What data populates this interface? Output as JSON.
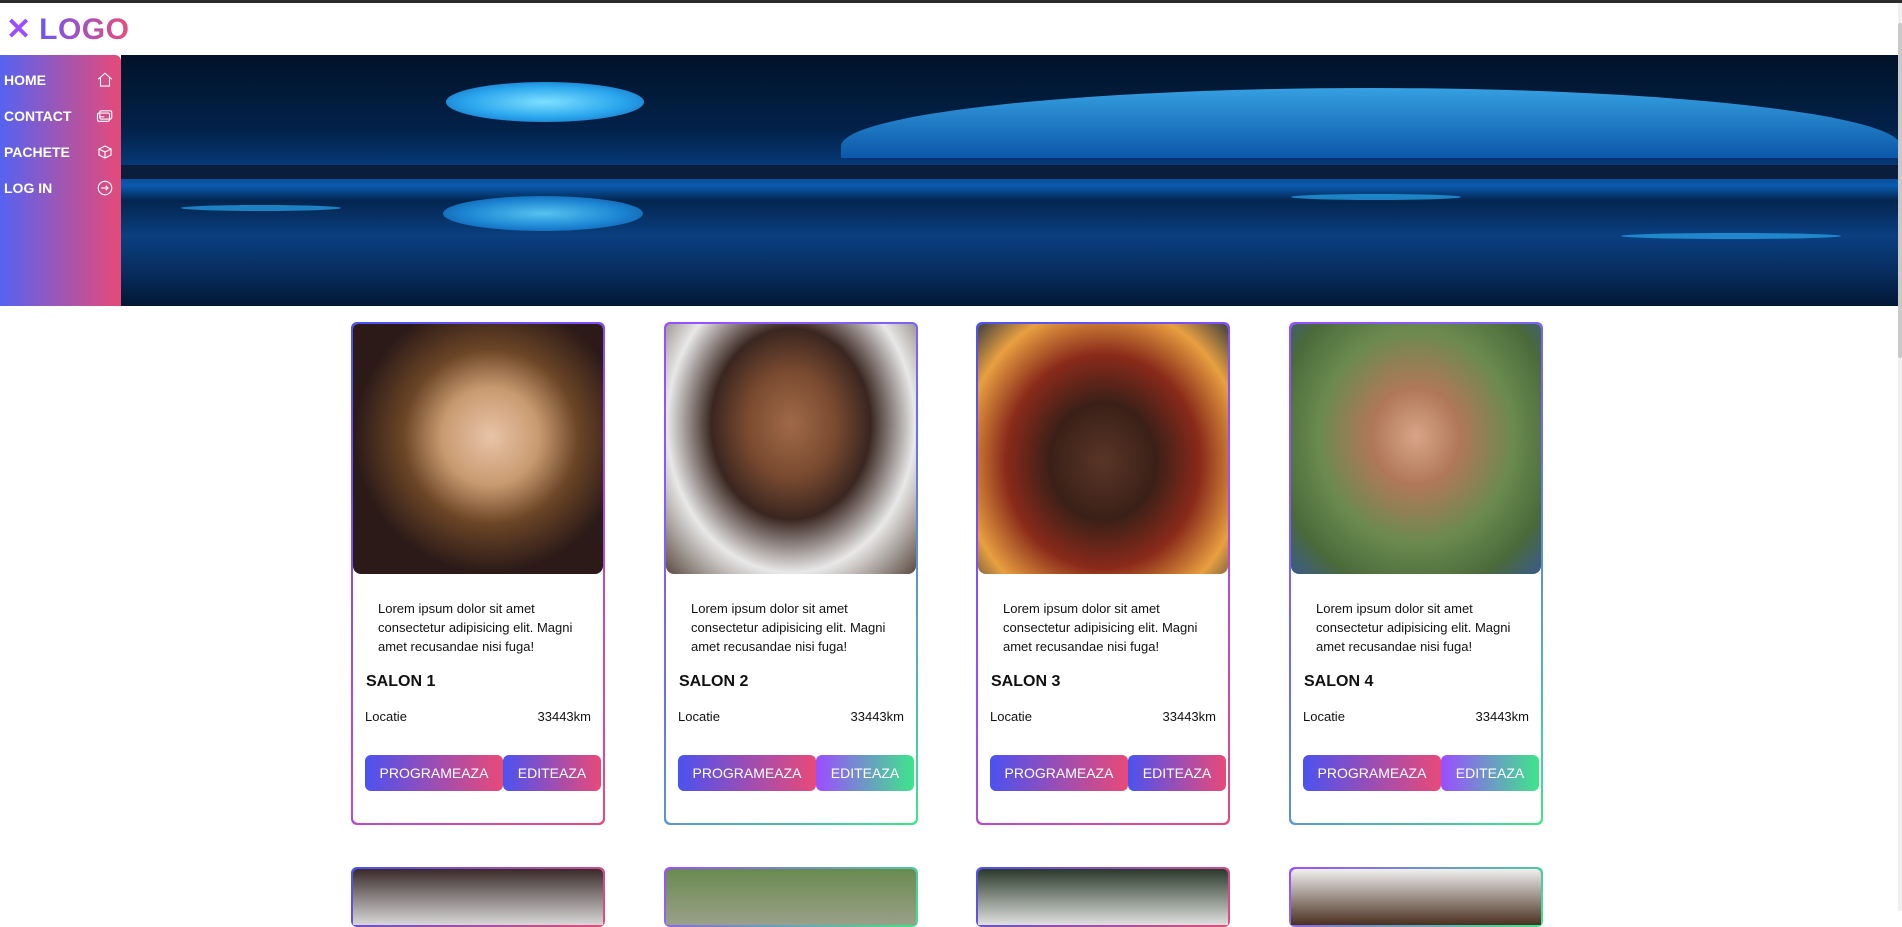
{
  "header": {
    "logo_mark": "✕",
    "logo_text": "LOGO"
  },
  "sidebar": {
    "items": [
      {
        "label": "HOME",
        "icon": "home-icon"
      },
      {
        "label": "CONTACT",
        "icon": "contact-card-icon"
      },
      {
        "label": "PACHETE",
        "icon": "package-icon"
      },
      {
        "label": "LOG IN",
        "icon": "login-icon"
      }
    ]
  },
  "cards": [
    {
      "description": "Lorem ipsum dolor sit amet consectetur adipisicing elit. Magni amet recusandae nisi fuga!",
      "title": "SALON 1",
      "location_label": "Locatie",
      "distance": "33443km",
      "primary_button": "PROGRAMEAZA",
      "secondary_button": "EDITEAZA"
    },
    {
      "description": "Lorem ipsum dolor sit amet consectetur adipisicing elit. Magni amet recusandae nisi fuga!",
      "title": "SALON 2",
      "location_label": "Locatie",
      "distance": "33443km",
      "primary_button": "PROGRAMEAZA",
      "secondary_button": "EDITEAZA"
    },
    {
      "description": "Lorem ipsum dolor sit amet consectetur adipisicing elit. Magni amet recusandae nisi fuga!",
      "title": "SALON 3",
      "location_label": "Locatie",
      "distance": "33443km",
      "primary_button": "PROGRAMEAZA",
      "secondary_button": "EDITEAZA"
    },
    {
      "description": "Lorem ipsum dolor sit amet consectetur adipisicing elit. Magni amet recusandae nisi fuga!",
      "title": "SALON 4",
      "location_label": "Locatie",
      "distance": "33443km",
      "primary_button": "PROGRAMEAZA",
      "secondary_button": "EDITEAZA"
    }
  ],
  "colors": {
    "accent_blue": "#4c52ef",
    "accent_pink": "#e84a78",
    "accent_purple": "#9b4dff",
    "accent_green": "#3ee58a"
  }
}
